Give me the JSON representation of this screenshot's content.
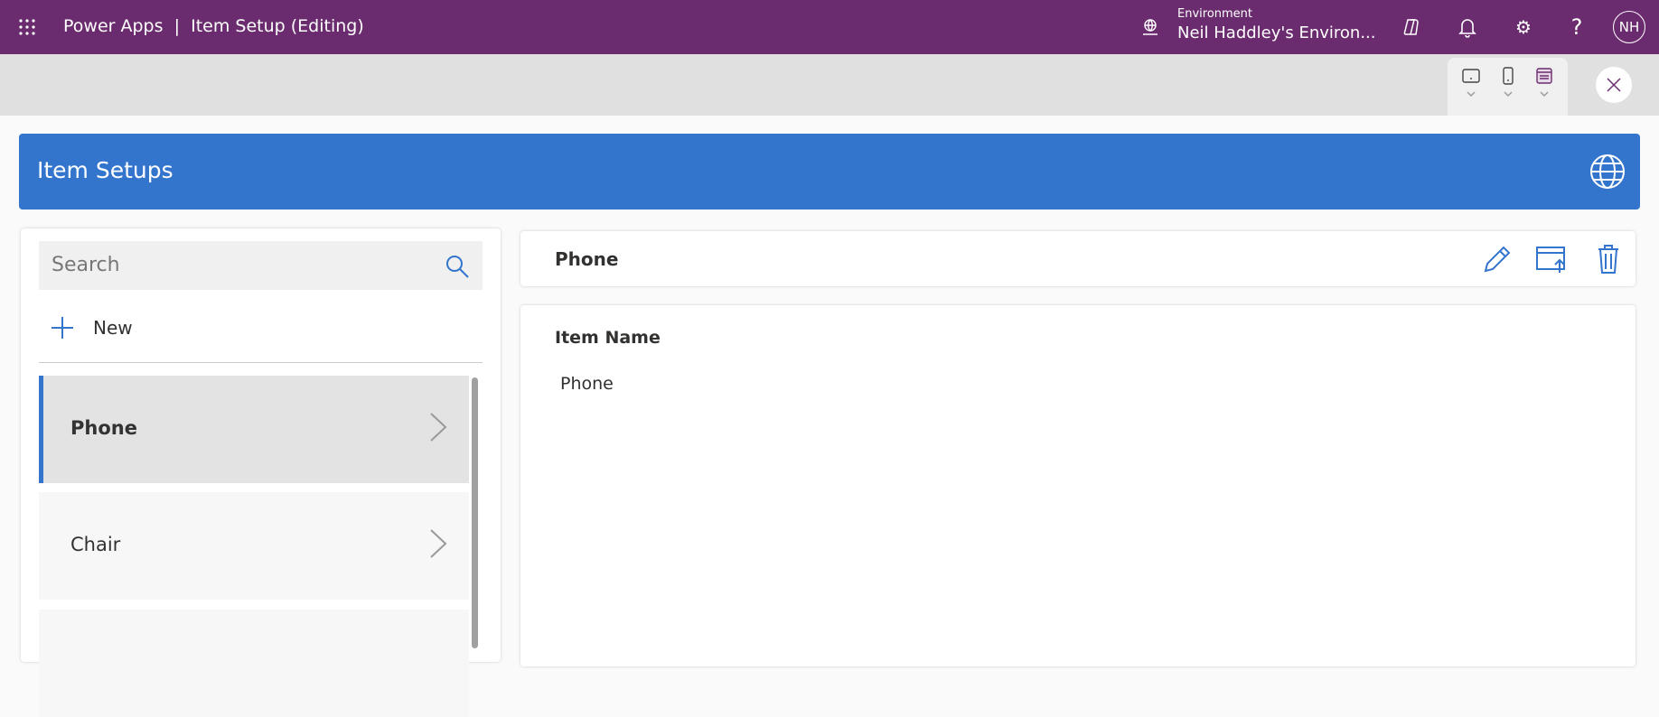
{
  "header": {
    "app_name": "Power Apps",
    "separator": "|",
    "page_title": "Item Setup (Editing)",
    "environment_label": "Environment",
    "environment_name": "Neil Haddley's Environ...",
    "avatar_initials": "NH"
  },
  "app": {
    "title": "Item Setups",
    "search_placeholder": "Search",
    "new_label": "New",
    "items": [
      {
        "label": "Phone"
      },
      {
        "label": "Chair"
      },
      {
        "label": ""
      }
    ],
    "detail": {
      "header_title": "Phone",
      "field_label": "Item Name",
      "field_value": "Phone"
    }
  },
  "colors": {
    "topbar": "#6b2c6f",
    "banner": "#3375cc",
    "accent": "#3375cc"
  }
}
